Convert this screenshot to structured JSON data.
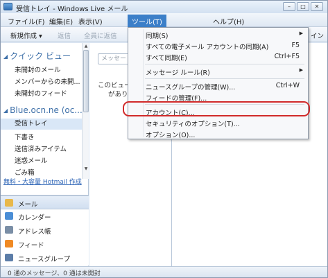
{
  "window": {
    "title": "受信トレイ - Windows Live メール",
    "controls": {
      "minimize": "–",
      "maximize": "□",
      "close": "✕"
    }
  },
  "menubar": {
    "items": [
      {
        "label": "ファイル(F)"
      },
      {
        "label": "編集(E)"
      },
      {
        "label": "表示(V)"
      },
      {
        "label": "ツール(T)",
        "active": true
      },
      {
        "label": "ヘルプ(H)"
      }
    ]
  },
  "toolbar": {
    "new": "新規作成 ▾",
    "reply": "返信",
    "reply_all": "全員に返信",
    "signin": "イン"
  },
  "nav": {
    "quick_view": {
      "header": "クイック ビュー",
      "items": [
        "未開封のメール",
        "メンバーからの未開...",
        "未開封のフィード"
      ]
    },
    "account": {
      "header": "Blue.ocn.ne (oc...",
      "items": [
        "受信トレイ",
        "下書き",
        "送信済みアイテム",
        "迷惑メール",
        "ごみ箱"
      ]
    },
    "promo": "無料・大容量 Hotmail 作成",
    "buttons": [
      {
        "label": "メール",
        "icon": "mail-icon",
        "color": "#e8b84a"
      },
      {
        "label": "カレンダー",
        "icon": "calendar-icon",
        "color": "#4b8ed6"
      },
      {
        "label": "アドレス帳",
        "icon": "contacts-icon",
        "color": "#7a8ea6"
      },
      {
        "label": "フィード",
        "icon": "feed-icon",
        "color": "#f08a24"
      },
      {
        "label": "ニュースグループ",
        "icon": "newsgroup-icon",
        "color": "#5c7da8"
      }
    ]
  },
  "msglist": {
    "search_placeholder": "メッセー",
    "empty_line1": "このビュー",
    "empty_line2": "があり"
  },
  "status": {
    "text": "0 通のメッセージ、0 通は未開封"
  },
  "tools_menu": {
    "items": [
      {
        "label": "同期(S)",
        "shortcut": "",
        "submenu": true
      },
      {
        "label": "すべての電子メール アカウントの同期(A)",
        "shortcut": "F5",
        "submenu": false
      },
      {
        "label": "すべて同期(E)",
        "shortcut": "Ctrl+F5",
        "submenu": false
      },
      {
        "label": "メッセージ ルール(R)",
        "shortcut": "",
        "submenu": true
      },
      {
        "label": "ニュースグループの管理(W)...",
        "shortcut": "Ctrl+W",
        "submenu": false
      },
      {
        "label": "フィードの管理(F)...",
        "shortcut": "",
        "submenu": false
      },
      {
        "label": "アカウント(C)...",
        "shortcut": "",
        "submenu": false
      },
      {
        "label": "セキュリティのオプション(T)...",
        "shortcut": "",
        "submenu": false
      },
      {
        "label": "オプション(O)...",
        "shortcut": "",
        "submenu": false
      }
    ]
  },
  "annotation": {
    "highlight_color": "#d12a2a"
  }
}
